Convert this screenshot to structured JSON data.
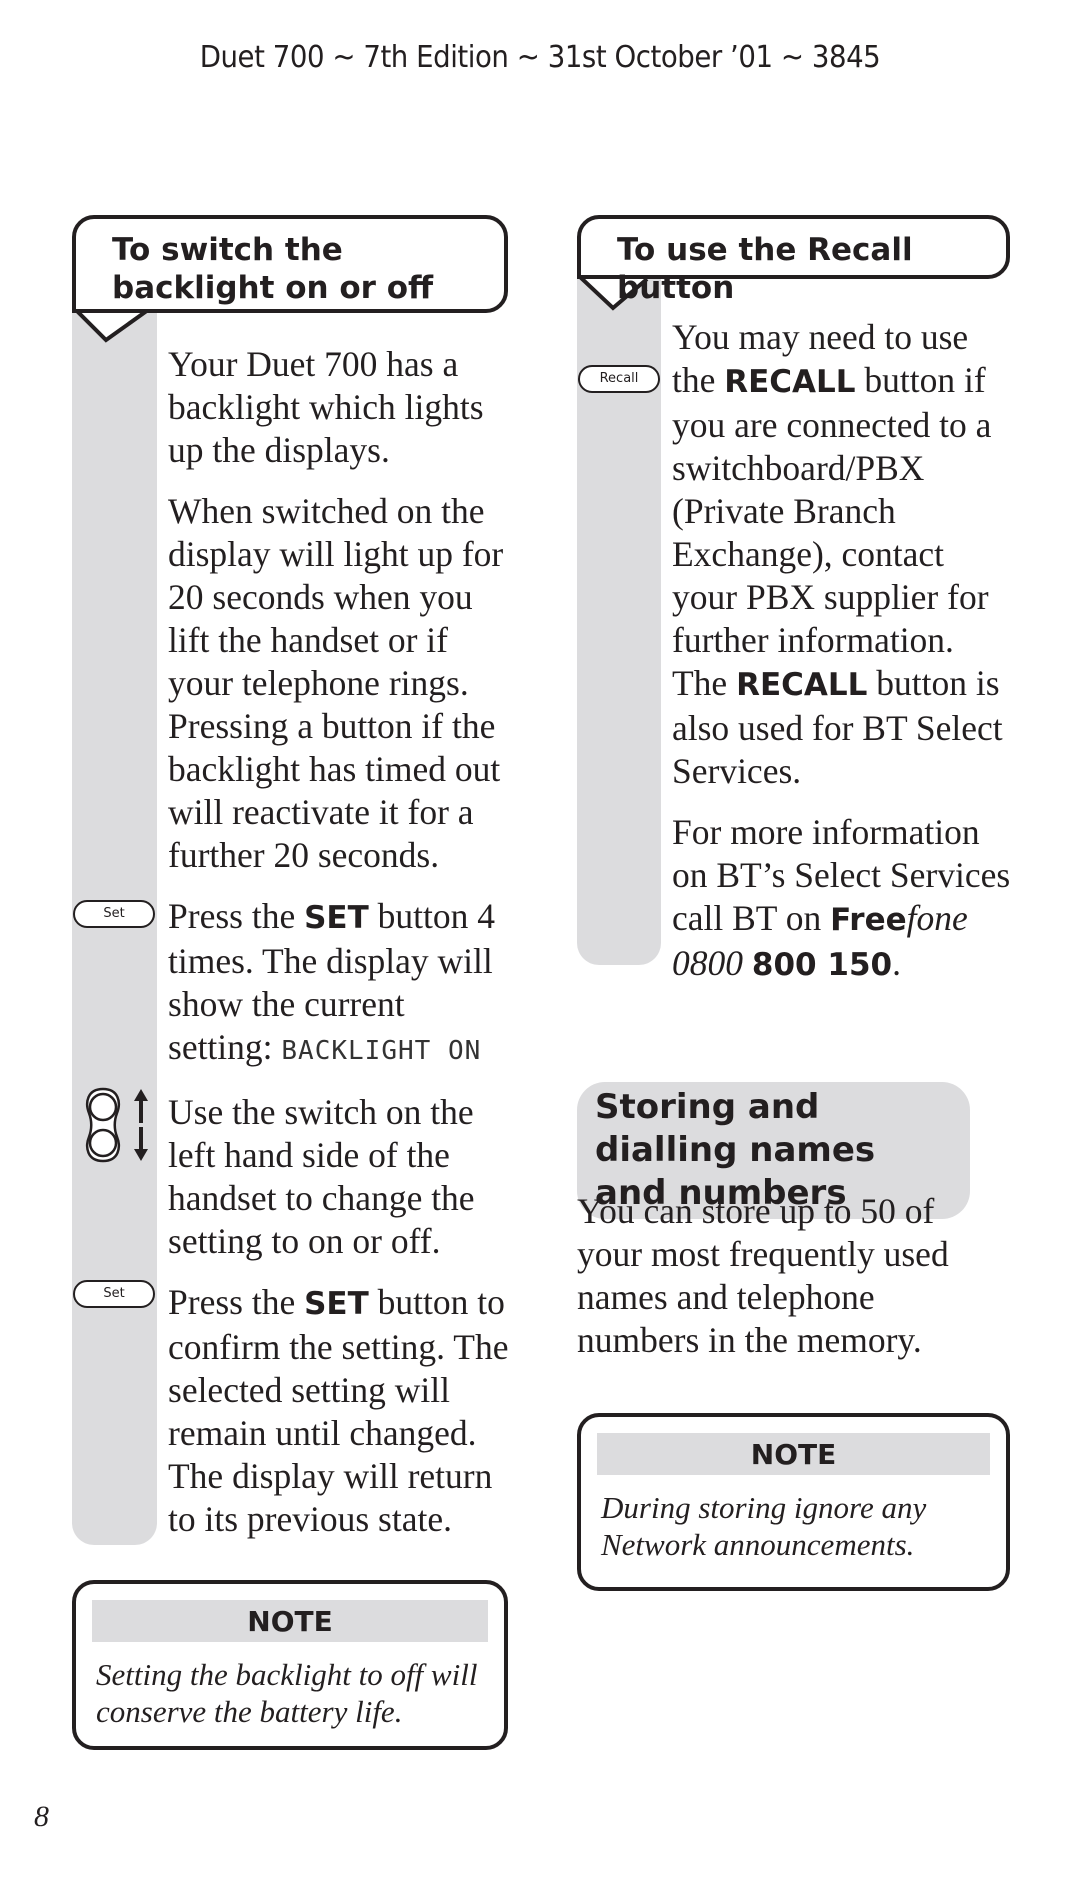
{
  "header": {
    "running_head": "Duet 700 ~ 7th Edition ~ 31st October ’01 ~ 3845"
  },
  "left_column": {
    "heading": "To switch the backlight on or off",
    "intro": [
      "Your Duet 700 has a backlight which lights up the displays.",
      "When switched on the display will light up for 20 seconds when you lift the handset or if your telephone rings. Pressing a button if the backlight has timed out will reactivate it for a further 20 seconds."
    ],
    "steps": [
      {
        "key_label": "Set",
        "icon": "set-key-icon",
        "text_before": "Press the ",
        "bold": "SET",
        "text_after": " button 4 times. The display will show the current setting: ",
        "display_readout": "BACKLIGHT ON"
      },
      {
        "icon": "side-switch-icon",
        "text": "Use the switch on the left hand side of the handset to change the setting to on or off."
      },
      {
        "key_label": "Set",
        "icon": "set-key-icon",
        "text_before": "Press the ",
        "bold": "SET",
        "text_after": " button to confirm the setting. The selected setting will remain until changed. The display will return to its previous state."
      }
    ],
    "note": {
      "title": "NOTE",
      "text": "Setting the backlight to off will conserve the battery life."
    }
  },
  "right_column": {
    "heading": "To use the Recall button",
    "key_label": "Recall",
    "paragraph1": {
      "text_before": "You may need to use the ",
      "bold": "RECALL",
      "text_middle": " button if you are connected to a switchboard/PBX (Private Branch Exchange), contact your PBX supplier for further information. The ",
      "bold2": "RECALL",
      "text_after": " button is also used for BT Select Services."
    },
    "paragraph2": {
      "text_before": "For more information on BT’s Select Services call BT on ",
      "free_bold": "Free",
      "free_italic": "fone",
      "number_italic": "0800",
      "number_bold": "800 150",
      "text_after": "."
    },
    "section_heading": "Storing and dialling names and numbers",
    "section_text": "You can store up to 50 of your most frequently used names and telephone numbers in the memory.",
    "note": {
      "title": "NOTE",
      "text": "During storing ignore any Network announcements."
    }
  },
  "footer": {
    "page_number": "8"
  }
}
